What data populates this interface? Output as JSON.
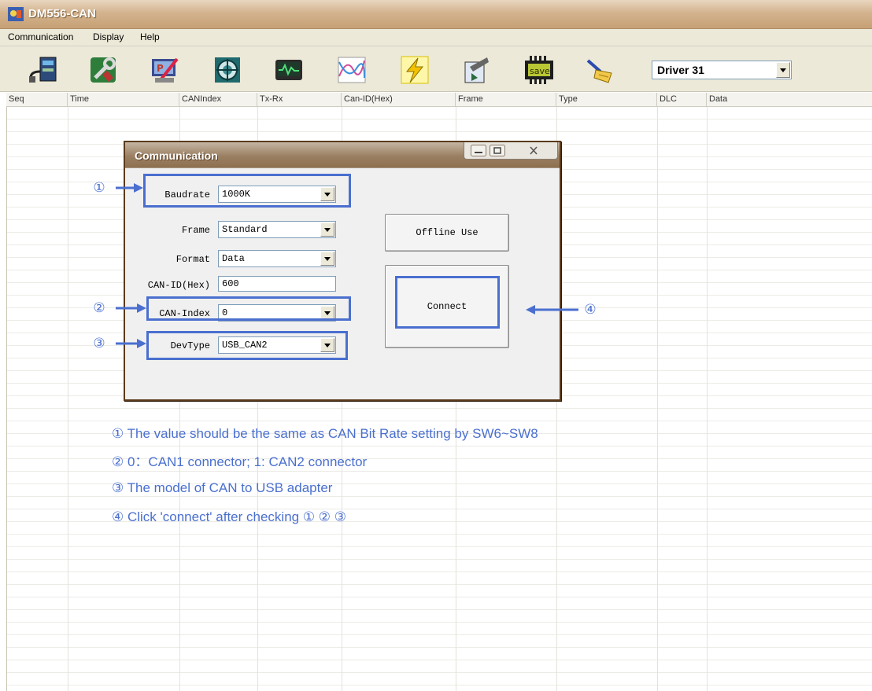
{
  "app": {
    "title": "DM556-CAN",
    "icon": "app-logo-icon"
  },
  "menu": [
    "Communication",
    "Display",
    "Help"
  ],
  "toolbar": {
    "buttons": [
      {
        "name": "serial-port-icon"
      },
      {
        "name": "wrench-tools-icon"
      },
      {
        "name": "parameter-edit-icon"
      },
      {
        "name": "motor-config-icon"
      },
      {
        "name": "oscilloscope-icon"
      },
      {
        "name": "waveform-chart-icon"
      },
      {
        "name": "lightning-icon"
      },
      {
        "name": "download-icon"
      },
      {
        "name": "save-chip-icon",
        "label": "save"
      },
      {
        "name": "clear-broom-icon"
      }
    ],
    "driver_select": "Driver 31"
  },
  "list": {
    "columns": [
      "Seq",
      "Time",
      "CANIndex",
      "Tx-Rx",
      "Can-ID(Hex)",
      "Frame",
      "Type",
      "DLC",
      "Data"
    ]
  },
  "dialog": {
    "title": "Communication",
    "fields": {
      "baudrate": {
        "label": "Baudrate",
        "value": "1000K"
      },
      "frame": {
        "label": "Frame",
        "value": "Standard"
      },
      "format": {
        "label": "Format",
        "value": "Data"
      },
      "canid": {
        "label": "CAN-ID(Hex)",
        "value": "600"
      },
      "canindex": {
        "label": "CAN-Index",
        "value": "0"
      },
      "devtype": {
        "label": "DevType",
        "value": "USB_CAN2"
      }
    },
    "offline_button": "Offline Use",
    "connect_button": "Connect"
  },
  "annotations": {
    "markers": [
      "①",
      "②",
      "③",
      "④"
    ],
    "color": "#4a6fcf",
    "notes": [
      "① The value should be the same as CAN Bit  Rate setting by SW6~SW8",
      "② 0：CAN1 connector;  1: CAN2 connector",
      "③ The model of CAN to USB adapter",
      "④ Click 'connect' after checking ① ② ③"
    ]
  }
}
